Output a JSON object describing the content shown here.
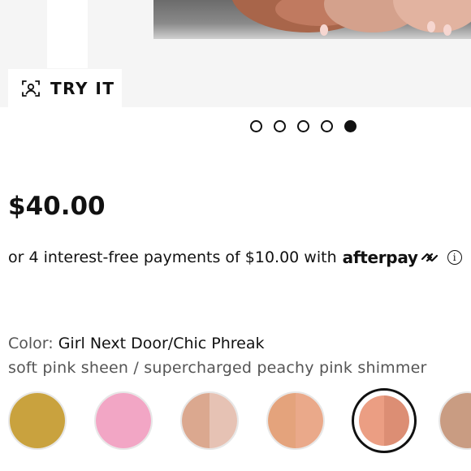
{
  "gallery": {
    "try_it_label": "TRY IT",
    "try_it_icon": "face-scan-icon",
    "dots_count": 5,
    "active_dot": 5
  },
  "product": {
    "price": "$40.00"
  },
  "afterpay": {
    "text": "or 4 interest-free payments of $10.00 with",
    "logo_text": "afterpay",
    "logo_icon": "afterpay-arrows-icon",
    "info_icon": "info-icon",
    "info_glyph": "i"
  },
  "shade": {
    "label": "Color:",
    "name": "Girl Next Door/Chic Phreak",
    "description": "soft pink sheen / supercharged peachy pink shimmer"
  },
  "swatches": [
    {
      "left": "#c9a23e",
      "right": "#c9a23e",
      "selected": false
    },
    {
      "left": "#f2a6c5",
      "right": "#f2a6c5",
      "selected": false
    },
    {
      "left": "#dba88f",
      "right": "#e6c2b4",
      "selected": false
    },
    {
      "left": "#e4a37c",
      "right": "#eaa98a",
      "selected": false
    },
    {
      "left": "#eb9e83",
      "right": "#dc8e74",
      "selected": true
    },
    {
      "left": "#c99c82",
      "right": "#c99c82",
      "selected": false
    }
  ]
}
